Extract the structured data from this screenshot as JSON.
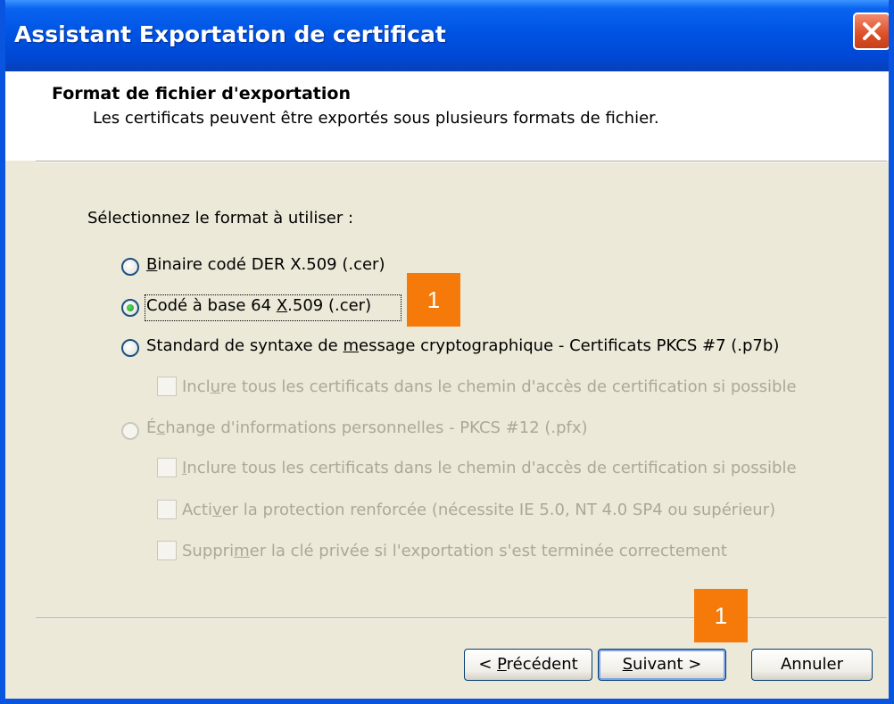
{
  "window": {
    "title": "Assistant Exportation de certificat"
  },
  "header": {
    "title": "Format de fichier d'exportation",
    "subtitle": "Les certificats peuvent être exportés sous plusieurs formats de fichier."
  },
  "prompt": "Sélectionnez le format à utiliser :",
  "options": {
    "der": {
      "pre": "",
      "key": "B",
      "post": "inaire codé DER X.509 (.cer)",
      "enabled": true,
      "selected": false
    },
    "base64": {
      "pre": "Codé à base 64 ",
      "key": "X",
      "post": ".509 (.cer)",
      "enabled": true,
      "selected": true
    },
    "pkcs7": {
      "pre": "Standard de syntaxe de ",
      "key": "m",
      "post": "essage cryptographique - Certificats PKCS #7 (.p7b)",
      "enabled": true,
      "selected": false
    },
    "pkcs7_include": {
      "pre": "Incl",
      "key": "u",
      "post": "re tous les certificats dans le chemin d'accès de certification si possible",
      "enabled": false,
      "checked": false
    },
    "pfx": {
      "pre": "É",
      "key": "c",
      "post": "hange d'informations personnelles - PKCS #12 (.pfx)",
      "enabled": false,
      "selected": false
    },
    "pfx_include": {
      "pre": "",
      "key": "I",
      "post": "nclure tous les certificats dans le chemin d'accès de certification si possible",
      "enabled": false,
      "checked": false
    },
    "pfx_strong": {
      "pre": "Acti",
      "key": "v",
      "post": "er la protection renforcée (nécessite IE 5.0, NT 4.0 SP4 ou supérieur)",
      "enabled": false,
      "checked": false
    },
    "pfx_delete": {
      "pre": "Suppri",
      "key": "m",
      "post": "er la clé privée si l'exportation s'est terminée correctement",
      "enabled": false,
      "checked": false
    }
  },
  "badges": {
    "option_marker": "1",
    "next_marker": "1"
  },
  "buttons": {
    "back": {
      "pre": "< ",
      "key": "P",
      "post": "récédent"
    },
    "next": {
      "pre": "",
      "key": "S",
      "post": "uivant >"
    },
    "cancel": {
      "label": "Annuler"
    }
  },
  "colors": {
    "titlebar": "#0054e3",
    "dialog_bg": "#ece9d8",
    "close_button": "#dd4e25",
    "badge": "#f57a0a",
    "disabled_text": "#aca899",
    "radio_selected_dot": "#2fb02f"
  },
  "icons": {
    "close": "close-x-icon"
  }
}
